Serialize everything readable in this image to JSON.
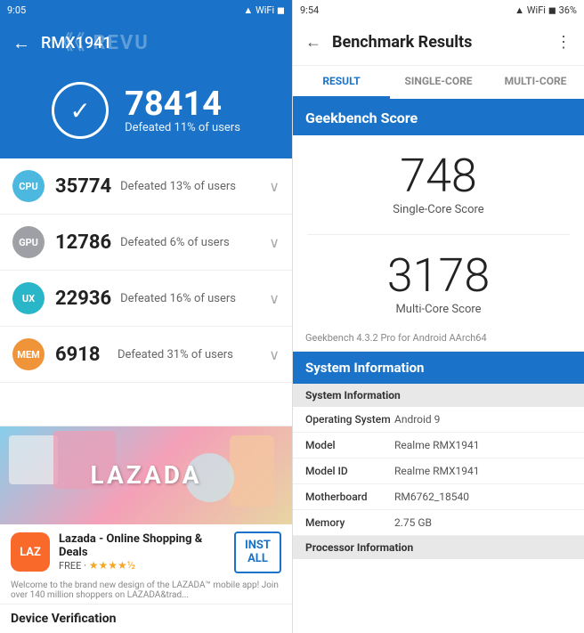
{
  "left": {
    "statusBar": {
      "time": "9:05",
      "icons": "WiFi Signal"
    },
    "header": {
      "back": "←",
      "deviceName": "RMX1941"
    },
    "watermark": "《《 REVU",
    "score": {
      "checkmark": "✓",
      "number": "78414",
      "subtitle": "Defeated 11% of users"
    },
    "metrics": [
      {
        "icon": "CPU",
        "value": "35774",
        "desc": "Defeated 13% of users",
        "iconClass": "icon-cpu"
      },
      {
        "icon": "GPU",
        "value": "12786",
        "desc": "Defeated 6% of users",
        "iconClass": "icon-gpu"
      },
      {
        "icon": "UX",
        "value": "22936",
        "desc": "Defeated 16% of users",
        "iconClass": "icon-ux"
      },
      {
        "icon": "MEM",
        "value": "6918",
        "desc": "Defeated 31% of users",
        "iconClass": "icon-mem"
      }
    ],
    "ad": {
      "bannerText": "LAZADA",
      "logoText": "LAZ",
      "title": "Lazada - Online Shopping & Deals",
      "subtitle": "FREE · ★★★★½",
      "installBtn": "INST\nALL",
      "desc": "Welcome to the brand new design of the LAZADA™ mobile app! Join over 140 million shoppers on LAZADA&trad...",
      "infoIcon": "ℹ"
    },
    "deviceVerification": "Device Verification"
  },
  "right": {
    "statusBar": {
      "time": "9:54",
      "icons": "WiFi Signal Battery"
    },
    "header": {
      "back": "←",
      "title": "Benchmark Results",
      "menu": "⋮"
    },
    "tabs": [
      {
        "label": "RESULT",
        "active": true
      },
      {
        "label": "SINGLE-CORE",
        "active": false
      },
      {
        "label": "MULTI-CORE",
        "active": false
      }
    ],
    "geekbenchHeader": "Geekbench Score",
    "singleCoreScore": "748",
    "singleCoreLabel": "Single-Core Score",
    "multiCoreScore": "3178",
    "multiCoreLabel": "Multi-Core Score",
    "versionText": "Geekbench 4.3.2 Pro for Android AArch64",
    "sysInfoHeader": "System Information",
    "sysSection": "System Information",
    "rows": [
      {
        "key": "Operating System",
        "val": "Android 9"
      },
      {
        "key": "Model",
        "val": "Realme RMX1941"
      },
      {
        "key": "Model ID",
        "val": "Realme RMX1941"
      },
      {
        "key": "Motherboard",
        "val": "RM6762_18540"
      },
      {
        "key": "Memory",
        "val": "2.75 GB"
      }
    ],
    "processorSection": "Processor Information"
  }
}
